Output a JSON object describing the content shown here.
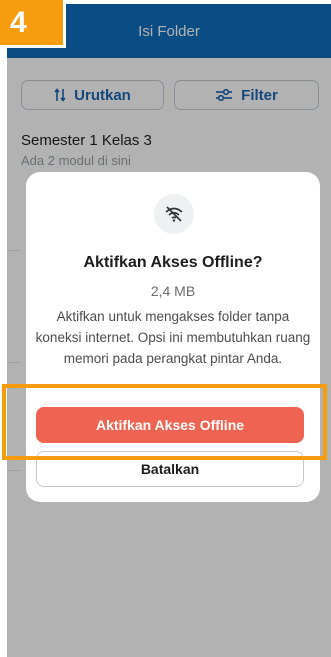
{
  "header": {
    "title": "Isi Folder"
  },
  "toolbar": {
    "sort_label": "Urutkan",
    "filter_label": "Filter"
  },
  "folder": {
    "title": "Semester 1 Kelas 3",
    "subtitle": "Ada 2 modul di sini"
  },
  "dialog": {
    "icon": "wifi-off-icon",
    "title": "Aktifkan Akses Offline?",
    "size": "2,4 MB",
    "description": "Aktifkan untuk mengakses folder tanpa koneksi internet. Opsi ini membutuhkan ruang memori pada perangkat pintar Anda.",
    "confirm_label": "Aktifkan Akses Offline",
    "cancel_label": "Batalkan"
  },
  "annotation": {
    "step_number": "4",
    "highlight_color": "#f59c0f"
  },
  "colors": {
    "header": "#0f6fbd",
    "accent": "#1c66b5",
    "confirm": "#ef6352"
  }
}
